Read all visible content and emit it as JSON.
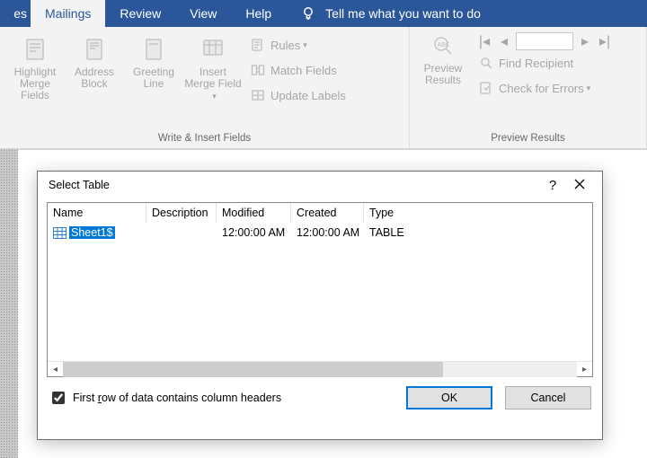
{
  "tabs": {
    "partial_left": "es",
    "items": [
      "Mailings",
      "Review",
      "View",
      "Help"
    ],
    "active_index": 0,
    "tellme": "Tell me what you want to do"
  },
  "ribbon": {
    "write_insert": {
      "highlight": "Highlight Merge Fields",
      "address": "Address Block",
      "greeting": "Greeting Line",
      "insert": "Insert Merge Field",
      "rules": "Rules",
      "match": "Match Fields",
      "update": "Update Labels",
      "group_label": "Write & Insert Fields"
    },
    "preview": {
      "preview": "Preview Results",
      "find": "Find Recipient",
      "errors": "Check for Errors",
      "group_label": "Preview Results",
      "record_value": ""
    }
  },
  "dialog": {
    "title": "Select Table",
    "columns": {
      "name": "Name",
      "desc": "Description",
      "mod": "Modified",
      "crt": "Created",
      "type": "Type"
    },
    "rows": [
      {
        "name": "Sheet1$",
        "desc": "",
        "mod": "12:00:00 AM",
        "crt": "12:00:00 AM",
        "type": "TABLE"
      }
    ],
    "checkbox_label": "First row of data contains column headers",
    "checkbox_checked": true,
    "ok": "OK",
    "cancel": "Cancel",
    "help": "?"
  }
}
